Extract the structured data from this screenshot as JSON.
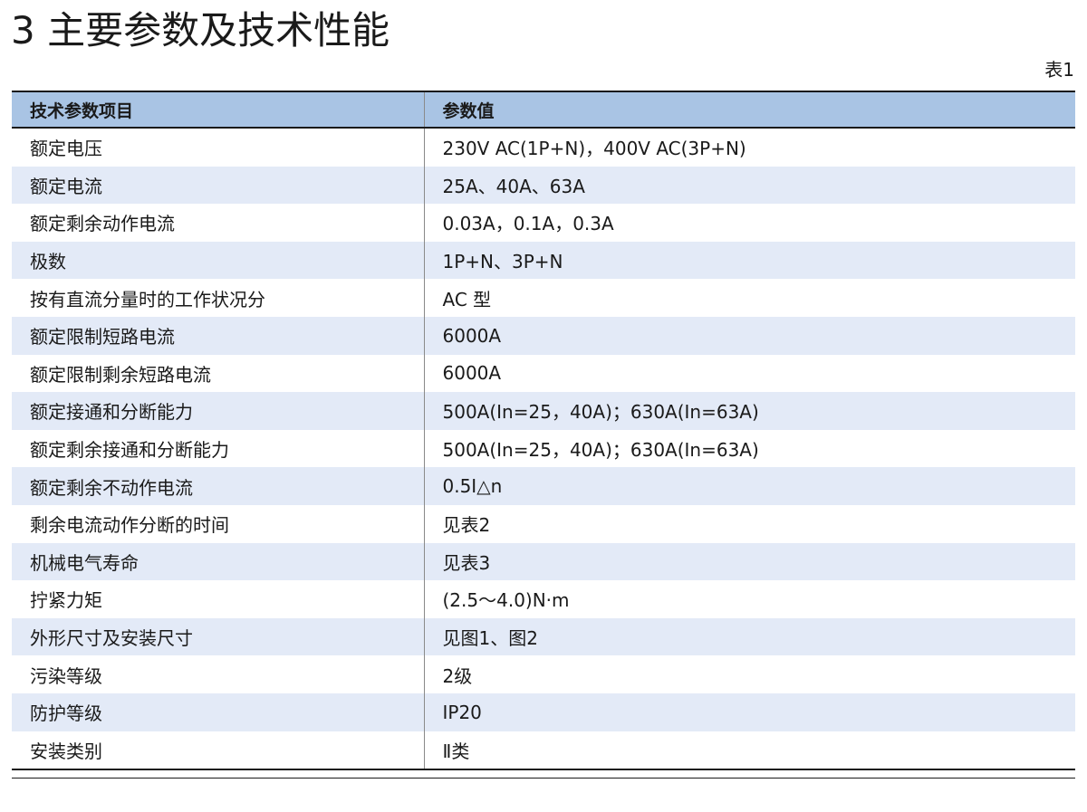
{
  "title": "3 主要参数及技术性能",
  "table_caption": "表1",
  "table": {
    "headers": [
      "技术参数项目",
      "参数值"
    ],
    "rows": [
      [
        "额定电压",
        "230V AC(1P+N)，400V AC(3P+N)"
      ],
      [
        "额定电流",
        "25A、40A、63A"
      ],
      [
        "额定剩余动作电流",
        "0.03A，0.1A，0.3A"
      ],
      [
        "极数",
        "1P+N、3P+N"
      ],
      [
        "按有直流分量时的工作状况分",
        "AC 型"
      ],
      [
        "额定限制短路电流",
        "6000A"
      ],
      [
        "额定限制剩余短路电流",
        "6000A"
      ],
      [
        "额定接通和分断能力",
        "500A(In=25，40A)；630A(In=63A)"
      ],
      [
        "额定剩余接通和分断能力",
        "500A(In=25，40A)；630A(In=63A)"
      ],
      [
        "额定剩余不动作电流",
        "0.5I△n"
      ],
      [
        "剩余电流动作分断的时间",
        "见表2"
      ],
      [
        "机械电气寿命",
        "见表3"
      ],
      [
        "拧紧力矩",
        "(2.5～4.0)N·m"
      ],
      [
        "外形尺寸及安装尺寸",
        "见图1、图2"
      ],
      [
        "污染等级",
        "2级"
      ],
      [
        "防护等级",
        "IP20"
      ],
      [
        "安装类别",
        "Ⅱ类"
      ]
    ]
  },
  "colors": {
    "header_bg": "#a9c4e4",
    "stripe_bg": "#e3eaf7",
    "rule": "#1a1a1a"
  }
}
